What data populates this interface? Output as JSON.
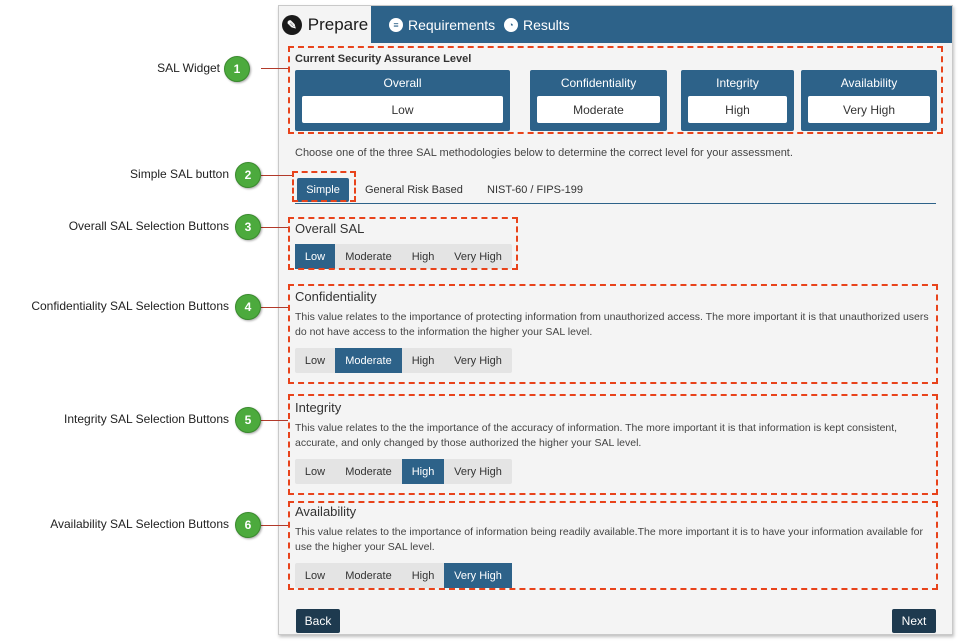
{
  "tabs": {
    "prepare": "Prepare",
    "requirements": "Requirements",
    "results": "Results"
  },
  "sal_widget": {
    "title": "Current Security Assurance Level",
    "cards": [
      {
        "label": "Overall",
        "value": "Low"
      },
      {
        "label": "Confidentiality",
        "value": "Moderate"
      },
      {
        "label": "Integrity",
        "value": "High"
      },
      {
        "label": "Availability",
        "value": "Very High"
      }
    ]
  },
  "intro": "Choose one of the three SAL methodologies below to determine the correct level for your assessment.",
  "methodologies": {
    "simple": "Simple",
    "general": "General Risk Based",
    "nist": "NIST-60 / FIPS-199"
  },
  "levels": [
    "Low",
    "Moderate",
    "High",
    "Very High"
  ],
  "sections": {
    "overall": {
      "title": "Overall SAL",
      "selected": "Low"
    },
    "confidentiality": {
      "title": "Confidentiality",
      "desc": "This value relates to the importance of protecting information from unauthorized access. The more important it is that unauthorized users do not have access to the information the higher your SAL level.",
      "selected": "Moderate"
    },
    "integrity": {
      "title": "Integrity",
      "desc": "This value relates to the the importance of the accuracy of information. The more important it is that information is kept consistent, accurate, and only changed by those authorized the higher your SAL level.",
      "selected": "High"
    },
    "availability": {
      "title": "Availability",
      "desc": "This value relates to the importance of information being readily available.The more important it is to have your information available for use the higher your SAL level.",
      "selected": "Very High"
    }
  },
  "nav": {
    "back": "Back",
    "next": "Next"
  },
  "callouts": [
    {
      "num": "1",
      "label": "SAL Widget"
    },
    {
      "num": "2",
      "label": "Simple SAL button"
    },
    {
      "num": "3",
      "label": "Overall SAL Selection Buttons"
    },
    {
      "num": "4",
      "label": "Confidentiality SAL Selection Buttons"
    },
    {
      "num": "5",
      "label": "Integrity SAL Selection Buttons"
    },
    {
      "num": "6",
      "label": "Availability SAL Selection Buttons"
    }
  ],
  "colors": {
    "accent": "#2d6289",
    "annotation": "#e8431b",
    "badge": "#4caa3d"
  }
}
